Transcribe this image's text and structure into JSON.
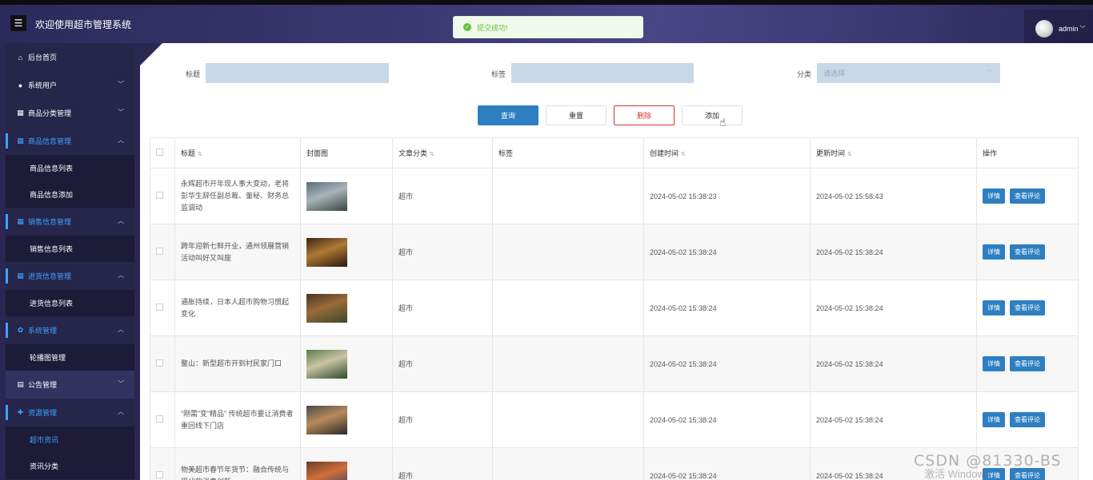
{
  "header": {
    "menu_icon": "☰",
    "title": "欢迎使用超市管理系统",
    "toast": "提交成功!",
    "username": "admin"
  },
  "sidebar": {
    "items": [
      {
        "label": "后台首页",
        "icon": "home-icon",
        "glyph": "⌂",
        "type": "item"
      },
      {
        "label": "系统用户",
        "icon": "user-icon",
        "glyph": "●",
        "type": "item",
        "arrow": "﹀"
      },
      {
        "label": "商品分类管理",
        "icon": "grid-icon",
        "glyph": "▦",
        "type": "item",
        "arrow": "﹀"
      },
      {
        "label": "商品信息管理",
        "icon": "grid-icon",
        "glyph": "▦",
        "type": "item",
        "arrow": "︿",
        "active": true
      },
      {
        "label": "商品信息列表",
        "type": "sub"
      },
      {
        "label": "商品信息添加",
        "type": "sub"
      },
      {
        "label": "销售信息管理",
        "icon": "grid-icon",
        "glyph": "▦",
        "type": "item",
        "arrow": "︿",
        "active": true
      },
      {
        "label": "销售信息列表",
        "type": "sub"
      },
      {
        "label": "进货信息管理",
        "icon": "grid-icon",
        "glyph": "▦",
        "type": "item",
        "arrow": "︿",
        "active": true
      },
      {
        "label": "进货信息列表",
        "type": "sub"
      },
      {
        "label": "系统管理",
        "icon": "gear-icon",
        "glyph": "✿",
        "type": "item",
        "arrow": "︿",
        "active": true
      },
      {
        "label": "轮播图管理",
        "type": "sub"
      },
      {
        "label": "公告管理",
        "icon": "notice-icon",
        "glyph": "▤",
        "type": "item",
        "arrow": "﹀",
        "highlight": true
      },
      {
        "label": "资源管理",
        "icon": "resource-icon",
        "glyph": "✚",
        "type": "item",
        "arrow": "︿",
        "active": true
      },
      {
        "label": "超市资讯",
        "type": "sub",
        "active": true
      },
      {
        "label": "资讯分类",
        "type": "sub"
      }
    ]
  },
  "search": {
    "title_label": "标题",
    "tag_label": "标签",
    "category_label": "分类",
    "category_placeholder": "请选择",
    "query": "查询",
    "reset": "重置",
    "delete": "删除",
    "add": "添加"
  },
  "table": {
    "headers": {
      "title": "标题",
      "cover": "封面图",
      "category": "文章分类",
      "tags": "标签",
      "created": "创建时间",
      "updated": "更新时间",
      "actions": "操作"
    },
    "detail_label": "详情",
    "comments_label": "查看评论",
    "rows": [
      {
        "title": "永辉超市开年现人事大变动，老将彭华生辞任副总裁、董秘、财务总监调动",
        "category": "超市",
        "tags": "",
        "created": "2024-05-02 15:38:23",
        "updated": "2024-05-02 15:58:43",
        "thumb": [
          "#5b6b7a",
          "#a9b4b9",
          "#38433f"
        ]
      },
      {
        "title": "跨年迎新七鲜开业，通州领展营销活动叫好又叫座",
        "category": "超市",
        "tags": "",
        "created": "2024-05-02 15:38:24",
        "updated": "2024-05-02 15:38:24",
        "thumb": [
          "#3a2414",
          "#b07a33",
          "#2a1a0f"
        ]
      },
      {
        "title": "通胀持续，日本人超市购物习惯起变化",
        "category": "超市",
        "tags": "",
        "created": "2024-05-02 15:38:24",
        "updated": "2024-05-02 15:38:24",
        "thumb": [
          "#4a3524",
          "#9a6a3a",
          "#3a4a2a"
        ]
      },
      {
        "title": "鳌山：新型超市开到村民家门口",
        "category": "超市",
        "tags": "",
        "created": "2024-05-02 15:38:24",
        "updated": "2024-05-02 15:38:24",
        "thumb": [
          "#5a7a4a",
          "#c9c4a6",
          "#2f4a2a"
        ]
      },
      {
        "title": "“刚需”变“精品” 传统超市要让消费者重回线下门店",
        "category": "超市",
        "tags": "",
        "created": "2024-05-02 15:38:24",
        "updated": "2024-05-02 15:38:24",
        "thumb": [
          "#4a4a4a",
          "#b88a5a",
          "#2a2a2a"
        ]
      },
      {
        "title": "物美超市春节年货节：融合传统与现代的消费创新",
        "category": "超市",
        "tags": "",
        "created": "2024-05-02 15:38:24",
        "updated": "2024-05-02 15:38:24",
        "thumb": [
          "#6a3a2a",
          "#d0703a",
          "#2a3a6a"
        ]
      }
    ]
  },
  "watermark": {
    "csdn": "CSDN @81330-BS",
    "windows": "激活 Windows"
  },
  "colors": {
    "accent": "#2d7fc1",
    "danger": "#d63232",
    "sidebar_active": "#3ea3ff"
  }
}
